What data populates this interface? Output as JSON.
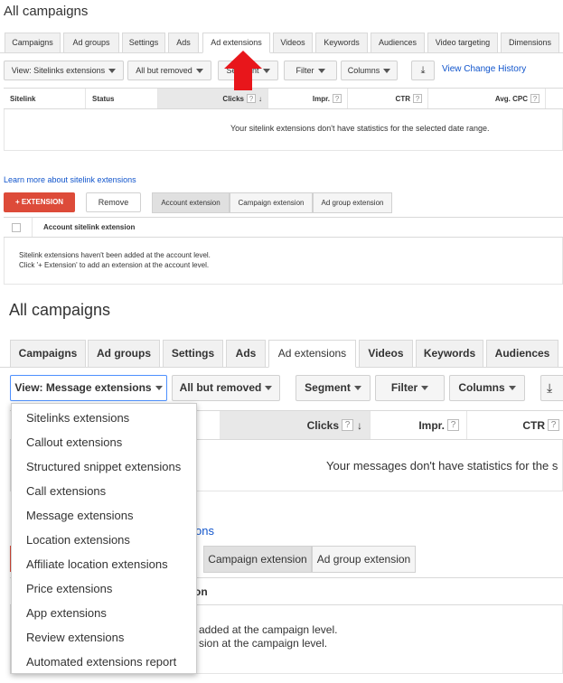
{
  "top": {
    "title": "All campaigns",
    "tabs": [
      "Campaigns",
      "Ad groups",
      "Settings",
      "Ads",
      "Ad extensions",
      "Videos",
      "Keywords",
      "Audiences",
      "Video targeting",
      "Dimensions"
    ],
    "toolbar": {
      "view": "View: Sitelinks extensions",
      "status_filter": "All but removed",
      "segment": "Segment",
      "filter": "Filter",
      "columns": "Columns",
      "download_icon": "download-icon",
      "history_link": "View Change History"
    },
    "table": {
      "headers": [
        "Sitelink",
        "Status",
        "Clicks",
        "Impr.",
        "CTR",
        "Avg. CPC"
      ],
      "empty": "Your sitelink extensions don't have statistics for the selected date range."
    },
    "learn_link": "Learn more about sitelink extensions",
    "add_button": "+ EXTENSION",
    "remove_button": "Remove",
    "levels": [
      "Account extension",
      "Campaign extension",
      "Ad group extension"
    ],
    "account_header": "Account sitelink extension",
    "account_empty_1": "Sitelink extensions haven't been added at the account level.",
    "account_empty_2": "Click '+ Extension' to add an extension at the account level.",
    "arrow_color": "#e8161b"
  },
  "bottom": {
    "title": "All campaigns",
    "tabs": [
      "Campaigns",
      "Ad groups",
      "Settings",
      "Ads",
      "Ad extensions",
      "Videos",
      "Keywords",
      "Audiences"
    ],
    "toolbar": {
      "view": "View: Message extensions",
      "status_filter": "All but removed",
      "segment": "Segment",
      "filter": "Filter",
      "columns": "Columns"
    },
    "table": {
      "headers": [
        "Clicks",
        "Impr.",
        "CTR"
      ],
      "empty": "Your messages don't have statistics for the s"
    },
    "learn_link_fragment": "ons",
    "levels": [
      "Campaign extension",
      "Ad group extension"
    ],
    "header_fragment": "on",
    "empty_1": "added at the campaign level.",
    "empty_2": "sion at the campaign level.",
    "dropdown": [
      "Sitelinks extensions",
      "Callout extensions",
      "Structured snippet extensions",
      "Call extensions",
      "Message extensions",
      "Location extensions",
      "Affiliate location extensions",
      "Price extensions",
      "App extensions",
      "Review extensions",
      "Automated extensions report"
    ]
  }
}
